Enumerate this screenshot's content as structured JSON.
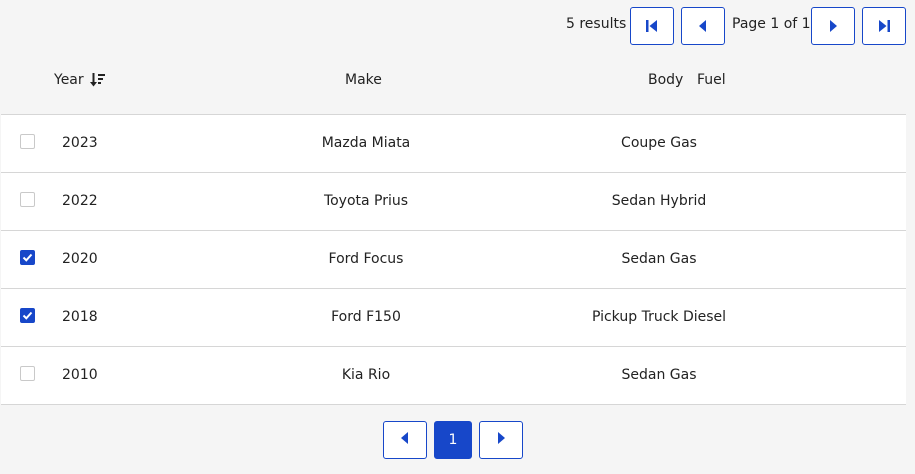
{
  "toolbar": {
    "results_label": "5 results",
    "page_label": "Page 1 of 1"
  },
  "columns": {
    "year": "Year",
    "make": "Make",
    "body": "Body",
    "fuel": "Fuel"
  },
  "rows": [
    {
      "year": "2023",
      "make": "Mazda Miata",
      "body_fuel": "Coupe Gas",
      "checked": false
    },
    {
      "year": "2022",
      "make": "Toyota Prius",
      "body_fuel": "Sedan Hybrid",
      "checked": false
    },
    {
      "year": "2020",
      "make": "Ford Focus",
      "body_fuel": "Sedan Gas",
      "checked": true
    },
    {
      "year": "2018",
      "make": "Ford F150",
      "body_fuel": "Pickup Truck Diesel",
      "checked": true
    },
    {
      "year": "2010",
      "make": "Kia Rio",
      "body_fuel": "Sedan Gas",
      "checked": false
    }
  ],
  "pager": {
    "current_page": "1"
  },
  "colors": {
    "accent": "#1747c9",
    "border": "#d6d6d6",
    "background": "#f5f5f5"
  },
  "icons": {
    "first": "first-page-icon",
    "prev": "previous-page-icon",
    "next": "next-page-icon",
    "last": "last-page-icon",
    "sort": "sort-descending-icon",
    "check": "checkmark-icon"
  }
}
